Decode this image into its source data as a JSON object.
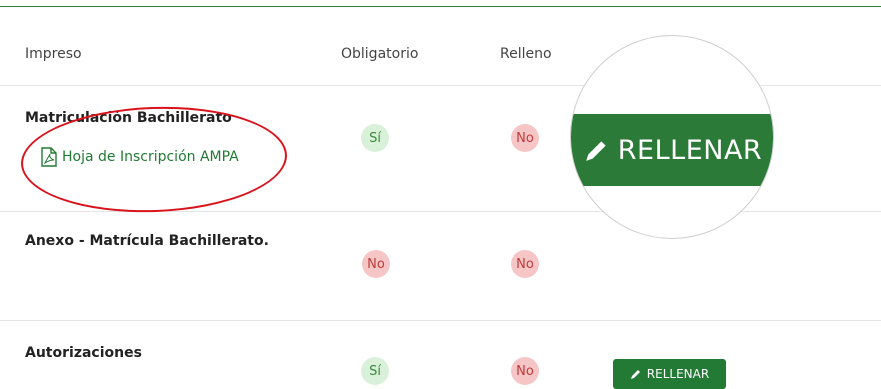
{
  "headers": {
    "form": "Impreso",
    "required": "Obligatorio",
    "filled": "Relleno"
  },
  "rows": [
    {
      "name": "Matriculación Bachillerato",
      "document_link": "Hoja de Inscripción AMPA",
      "required": "Sí",
      "filled": "No",
      "action": "RELLENAR"
    },
    {
      "name": "Anexo - Matrícula Bachillerato.",
      "required": "No",
      "filled": "No"
    },
    {
      "name": "Autorizaciones",
      "required": "Sí",
      "filled": "No",
      "action": "RELLENAR"
    }
  ],
  "icons": {
    "document": "pdf-file-icon",
    "edit": "pencil-icon"
  },
  "colors": {
    "brand_green": "#237a34",
    "yes_bg": "#d9f0d9",
    "yes_text": "#3a8a3a",
    "no_bg": "#f6c6c6",
    "no_text": "#c23b3b",
    "annotation_red": "#d9121b"
  }
}
